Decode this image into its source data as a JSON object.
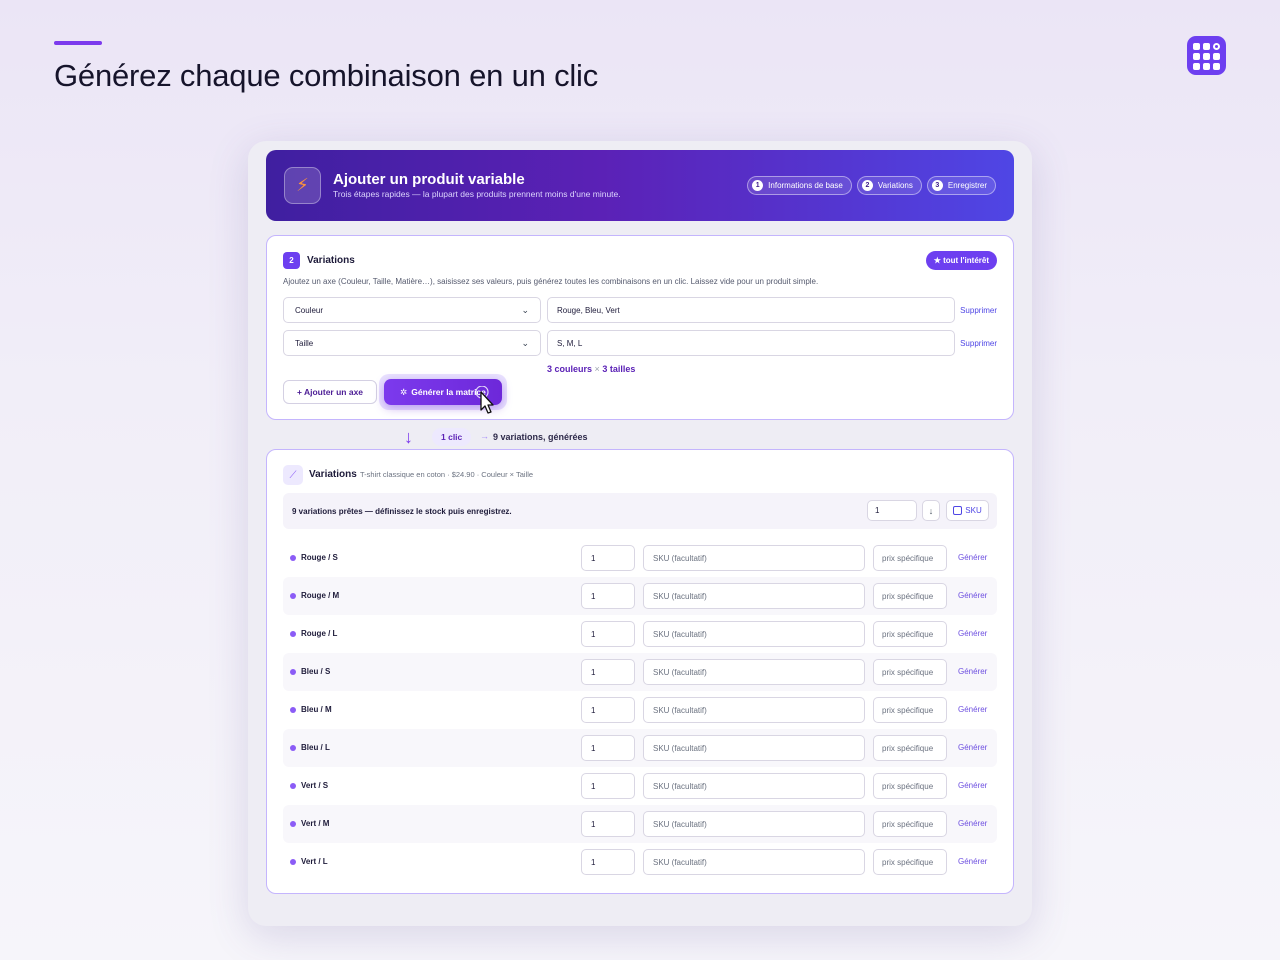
{
  "page": {
    "headline": "Générez chaque combinaison en un clic",
    "logo_icon": "grid-app-icon"
  },
  "hero": {
    "title": "Ajouter un produit variable",
    "subtitle": "Trois étapes rapides — la plupart des produits prennent moins d'une minute.",
    "icon": "lightning-icon",
    "steps": [
      {
        "num": "1",
        "label": "Informations de base"
      },
      {
        "num": "2",
        "label": "Variations"
      },
      {
        "num": "3",
        "label": "Enregistrer"
      }
    ]
  },
  "variations_setup": {
    "badge": "2",
    "title": "Variations",
    "interest_button": "★ tout l'intérêt",
    "description": "Ajoutez un axe (Couleur, Taille, Matière…), saisissez ses valeurs, puis générez toutes les combinaisons en un clic. Laissez vide pour un produit simple.",
    "axes": [
      {
        "name": "Couleur",
        "values": "Rouge, Bleu, Vert",
        "remove": "Supprimer"
      },
      {
        "name": "Taille",
        "values": "S, M, L",
        "remove": "Supprimer"
      }
    ],
    "count_a": "3 couleurs",
    "count_sep": "×",
    "count_b": "3 tailles",
    "add_axis": "+ Ajouter un axe",
    "generate": "Générer la matrice"
  },
  "click_indicator": {
    "pill": "1 clic",
    "arrow": "→",
    "result": "9 variations, générées"
  },
  "variations_list": {
    "title": "Variations",
    "meta": "T-shirt classique en coton · $24.90 · Couleur × Taille",
    "ready_text": "9 variations prêtes — définissez le stock puis enregistrez.",
    "bulk_stock": "1",
    "bulk_apply": "↓",
    "bulk_sku": "SKU",
    "rows": [
      {
        "name": "Rouge / S",
        "stock": "1",
        "sku_placeholder": "SKU (facultatif)",
        "price_placeholder": "prix spécifique",
        "action": "Générer"
      },
      {
        "name": "Rouge / M",
        "stock": "1",
        "sku_placeholder": "SKU (facultatif)",
        "price_placeholder": "prix spécifique",
        "action": "Générer"
      },
      {
        "name": "Rouge / L",
        "stock": "1",
        "sku_placeholder": "SKU (facultatif)",
        "price_placeholder": "prix spécifique",
        "action": "Générer"
      },
      {
        "name": "Bleu / S",
        "stock": "1",
        "sku_placeholder": "SKU (facultatif)",
        "price_placeholder": "prix spécifique",
        "action": "Générer"
      },
      {
        "name": "Bleu / M",
        "stock": "1",
        "sku_placeholder": "SKU (facultatif)",
        "price_placeholder": "prix spécifique",
        "action": "Générer"
      },
      {
        "name": "Bleu / L",
        "stock": "1",
        "sku_placeholder": "SKU (facultatif)",
        "price_placeholder": "prix spécifique",
        "action": "Générer"
      },
      {
        "name": "Vert / S",
        "stock": "1",
        "sku_placeholder": "SKU (facultatif)",
        "price_placeholder": "prix spécifique",
        "action": "Générer"
      },
      {
        "name": "Vert / M",
        "stock": "1",
        "sku_placeholder": "SKU (facultatif)",
        "price_placeholder": "prix spécifique",
        "action": "Générer"
      },
      {
        "name": "Vert / L",
        "stock": "1",
        "sku_placeholder": "SKU (facultatif)",
        "price_placeholder": "prix spécifique",
        "action": "Générer"
      }
    ]
  },
  "colors": {
    "accent": "#7c3aed",
    "hero_start": "#3f1fa0",
    "hero_end": "#4f46e5",
    "card_border": "#c4b5fd"
  }
}
